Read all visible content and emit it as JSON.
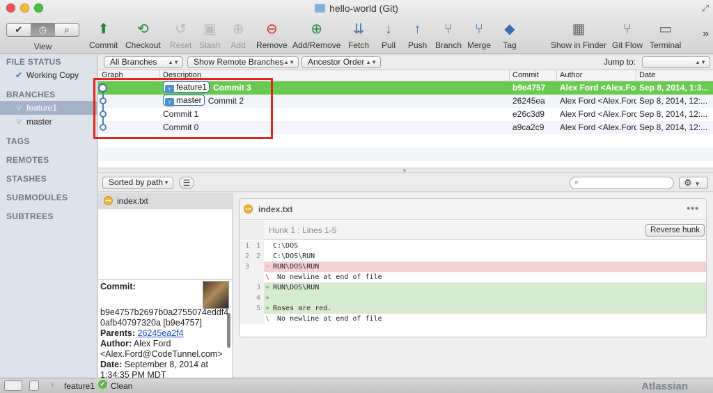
{
  "window": {
    "title": "hello-world (Git)"
  },
  "toolbar": {
    "view_label": "View",
    "view_modes": [
      "✔",
      "◷",
      "⌕"
    ],
    "buttons": [
      {
        "label": "Commit",
        "icon": "commit-icon",
        "enabled": true
      },
      {
        "label": "Checkout",
        "icon": "checkout-icon",
        "enabled": true
      },
      {
        "label": "Reset",
        "icon": "reset-icon",
        "enabled": false
      },
      {
        "label": "Stash",
        "icon": "stash-icon",
        "enabled": false
      },
      {
        "label": "Add",
        "icon": "add-icon",
        "enabled": false
      },
      {
        "label": "Remove",
        "icon": "remove-icon",
        "enabled": true
      },
      {
        "label": "Add/Remove",
        "icon": "add-remove-icon",
        "enabled": true
      },
      {
        "label": "Fetch",
        "icon": "fetch-icon",
        "enabled": true
      },
      {
        "label": "Pull",
        "icon": "pull-icon",
        "enabled": true
      },
      {
        "label": "Push",
        "icon": "push-icon",
        "enabled": true
      },
      {
        "label": "Branch",
        "icon": "branch-icon",
        "enabled": true
      },
      {
        "label": "Merge",
        "icon": "merge-icon",
        "enabled": true
      },
      {
        "label": "Tag",
        "icon": "tag-icon",
        "enabled": true
      },
      {
        "label": "Show in Finder",
        "icon": "finder-icon",
        "enabled": true
      },
      {
        "label": "Git Flow",
        "icon": "git-flow-icon",
        "enabled": true
      },
      {
        "label": "Terminal",
        "icon": "terminal-icon",
        "enabled": true
      }
    ],
    "overflow": "»"
  },
  "sidebar": {
    "file_status": "FILE STATUS",
    "working_copy": "Working Copy",
    "branches": "BRANCHES",
    "branch_items": [
      "feature1",
      "master"
    ],
    "tags": "TAGS",
    "remotes": "REMOTES",
    "stashes": "STASHES",
    "submodules": "SUBMODULES",
    "subtrees": "SUBTREES"
  },
  "filters": {
    "branches": "All Branches",
    "remote": "Show Remote Branches",
    "order": "Ancestor Order",
    "jump_to": "Jump to:"
  },
  "columns": {
    "graph": "Graph",
    "description": "Description",
    "commit": "Commit",
    "author": "Author",
    "date": "Date"
  },
  "commits": [
    {
      "tag": "feature1",
      "desc": "Commit 3",
      "hash": "b9e4757",
      "author": "Alex Ford <Alex.Ford@CodeTunnel.com>",
      "date": "Sep 8, 2014, 1:3..."
    },
    {
      "tag": "master",
      "desc": "Commit 2",
      "hash": "26245ea",
      "author": "Alex Ford <Alex.Ford@CodeTunnel.com>",
      "date": "Sep 8, 2014, 12:..."
    },
    {
      "tag": "",
      "desc": "Commit 1",
      "hash": "e26c3d9",
      "author": "Alex Ford <Alex.Ford@CodeTunnel.com>",
      "date": "Sep 8, 2014, 12:..."
    },
    {
      "tag": "",
      "desc": "Commit 0",
      "hash": "a9ca2c9",
      "author": "Alex Ford <Alex.Ford@CodeTunnel.com>",
      "date": "Sep 8, 2014, 12:..."
    }
  ],
  "files": {
    "sort": "Sorted by path",
    "items": [
      "index.txt"
    ]
  },
  "commit_info": {
    "commit_label": "Commit:",
    "commit_hash": "b9e4757b2697b0a2755074eddf40afb40797320a [b9e4757]",
    "parents_label": "Parents:",
    "parent": "26245ea2f4",
    "author_label": "Author:",
    "author": "Alex Ford <Alex.Ford@CodeTunnel.com>",
    "date_label": "Date:",
    "date": "September 8, 2014 at 1:34:35 PM MDT"
  },
  "diff": {
    "file": "index.txt",
    "hunk": "Hunk 1 : Lines 1-5",
    "reverse_button": "Reverse hunk",
    "lines": [
      {
        "n1": "1",
        "n2": "1",
        "sign": "",
        "text": "C:\\DOS",
        "kind": "ctx"
      },
      {
        "n1": "2",
        "n2": "2",
        "sign": "",
        "text": "C:\\DOS\\RUN",
        "kind": "ctx"
      },
      {
        "n1": "3",
        "n2": "",
        "sign": "-",
        "text": "RUN\\DOS\\RUN",
        "kind": "del"
      },
      {
        "n1": "",
        "n2": "",
        "sign": "\\",
        "text": " No newline at end of file",
        "kind": "ctx"
      },
      {
        "n1": "",
        "n2": "3",
        "sign": "+",
        "text": "RUN\\DOS\\RUN",
        "kind": "add"
      },
      {
        "n1": "",
        "n2": "4",
        "sign": "+",
        "text": "",
        "kind": "add"
      },
      {
        "n1": "",
        "n2": "5",
        "sign": "+",
        "text": "Roses are red.",
        "kind": "add"
      },
      {
        "n1": "",
        "n2": "",
        "sign": "\\",
        "text": " No newline at end of file",
        "kind": "ctx"
      }
    ]
  },
  "status": {
    "branch": "feature1",
    "state": "Clean",
    "brand": "Atlassian"
  },
  "colors": {
    "selected_row": "#6ac951",
    "highlight_box": "#e0251b",
    "sidebar_bg": "#dde3ea"
  }
}
